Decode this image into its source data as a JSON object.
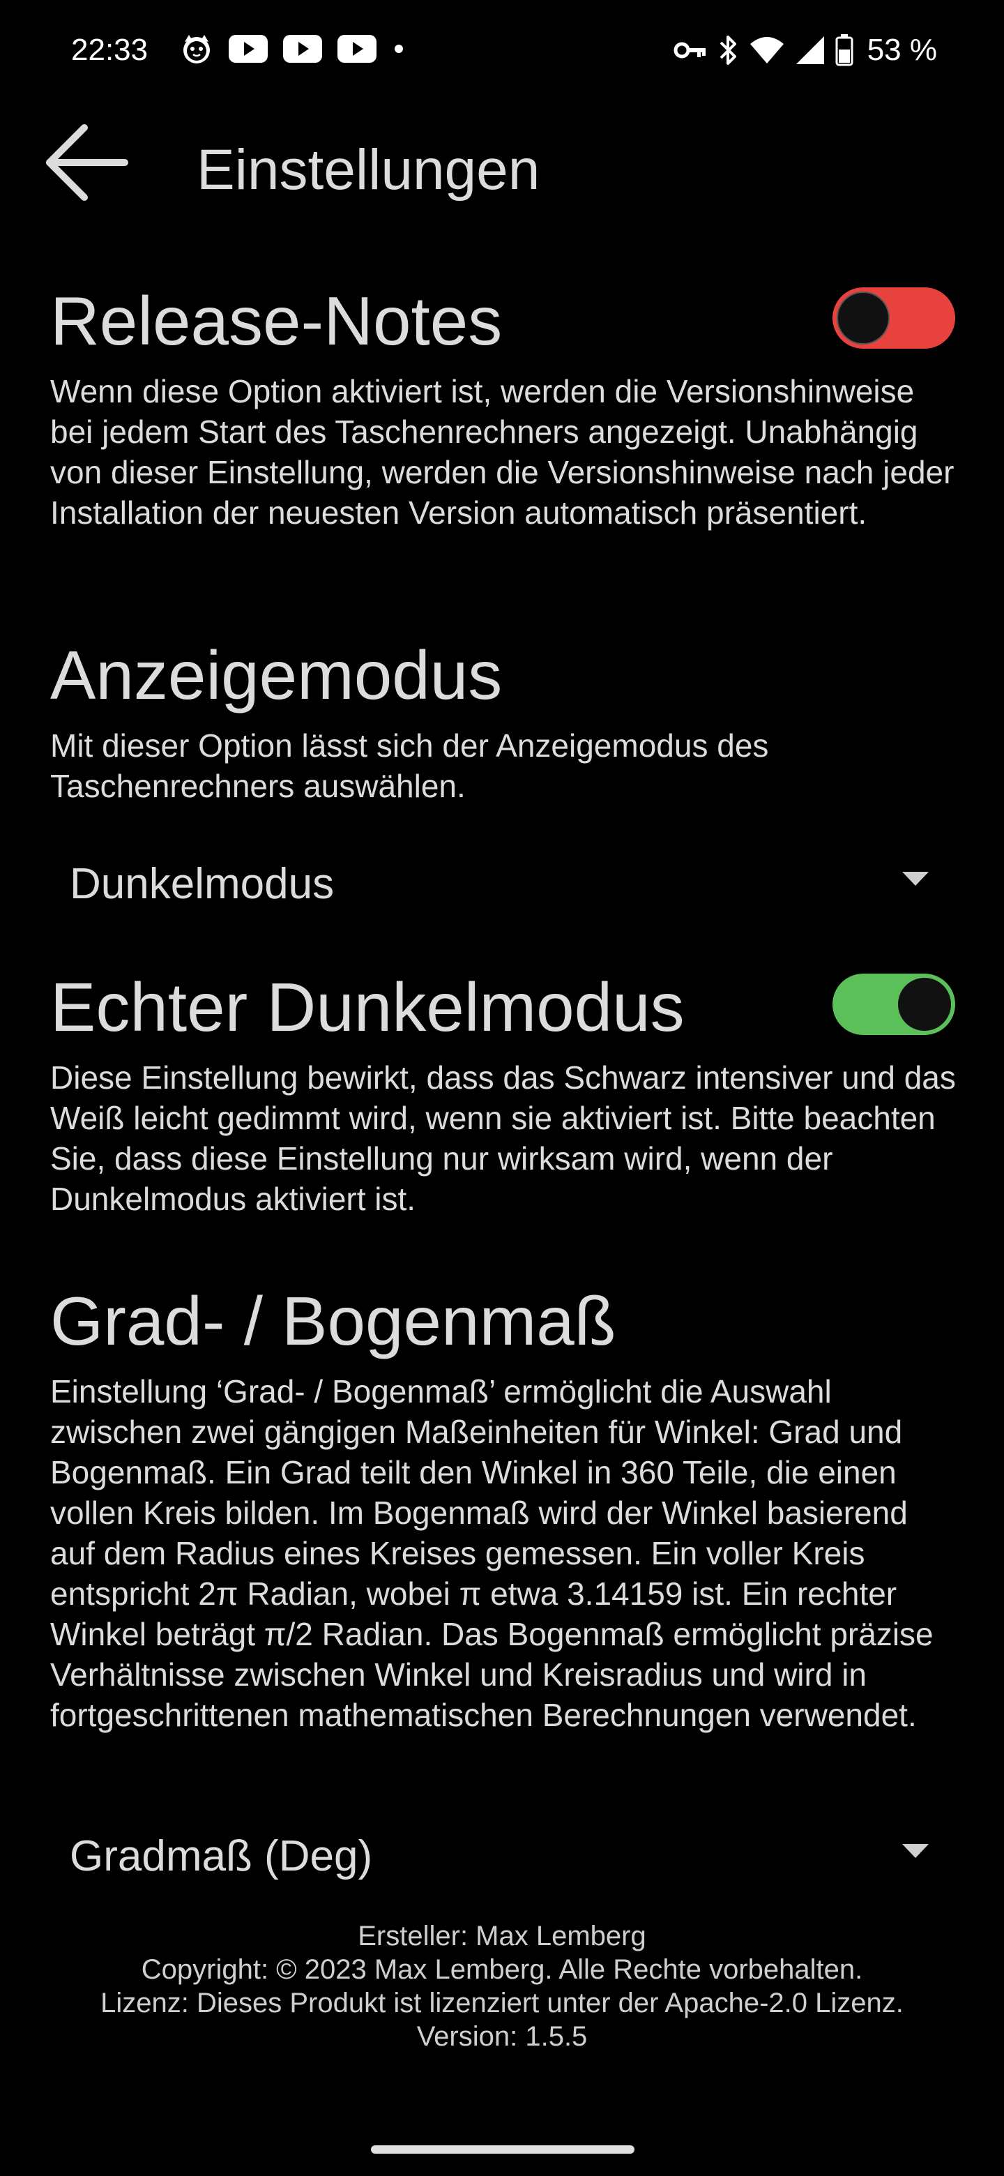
{
  "status_bar": {
    "time": "22:33",
    "battery_percent": "53 %",
    "left_icons": [
      "cat-app-icon",
      "youtube-icon",
      "youtube-icon",
      "youtube-icon",
      "dot-icon"
    ],
    "right_icons": [
      "vpn-key-icon",
      "bluetooth-icon",
      "wifi-icon",
      "signal-icon",
      "battery-icon"
    ]
  },
  "app_bar": {
    "back_icon": "arrow-left-icon",
    "title": "Einstellungen"
  },
  "release_notes": {
    "title": "Release-Notes",
    "description": "Wenn diese Option aktiviert ist, werden die Versionshinweise bei jedem Start des Taschenrechners angezeigt. Unabhängig von dieser Einstellung, werden die Versionshinweise nach jeder Installation der neuesten Version automatisch präsentiert.",
    "toggle_state": "off",
    "toggle_color": "#e8423f"
  },
  "display_mode": {
    "title": "Anzeigemodus",
    "description": "Mit dieser Option lässt sich der Anzeigemodus des Taschenrechners auswählen.",
    "selected": "Dunkelmodus"
  },
  "true_dark_mode": {
    "title": "Echter Dunkelmodus",
    "description": "Diese Einstellung bewirkt, dass das Schwarz intensiver und das Weiß leicht gedimmt wird, wenn sie aktiviert ist. Bitte beachten Sie, dass diese Einstellung nur wirksam wird, wenn der Dunkelmodus aktiviert ist.",
    "toggle_state": "on",
    "toggle_color": "#5bbf5a"
  },
  "angle_unit": {
    "title": "Grad- / Bogenmaß",
    "description": "Einstellung ‘Grad- / Bogenmaß’ ermöglicht die Auswahl zwischen zwei gängigen Maßeinheiten für Winkel: Grad und Bogenmaß. Ein Grad teilt den Winkel in 360 Teile, die einen vollen Kreis bilden. Im Bogenmaß wird der Winkel basierend auf dem Radius eines Kreises gemessen. Ein voller Kreis entspricht 2π Radian, wobei π etwa 3.14159 ist. Ein rechter Winkel beträgt π/2 Radian. Das Bogenmaß ermöglicht präzise Verhältnisse zwischen Winkel und Kreisradius und wird in fortgeschrittenen mathematischen Berechnungen verwendet.",
    "selected": "Gradmaß (Deg)"
  },
  "footer": {
    "author": "Ersteller: Max Lemberg",
    "copyright": "Copyright: © 2023 Max Lemberg. Alle Rechte vorbehalten.",
    "license": "Lizenz: Dieses Produkt ist lizenziert unter der Apache-2.0 Lizenz.",
    "version": "Version: 1.5.5"
  }
}
